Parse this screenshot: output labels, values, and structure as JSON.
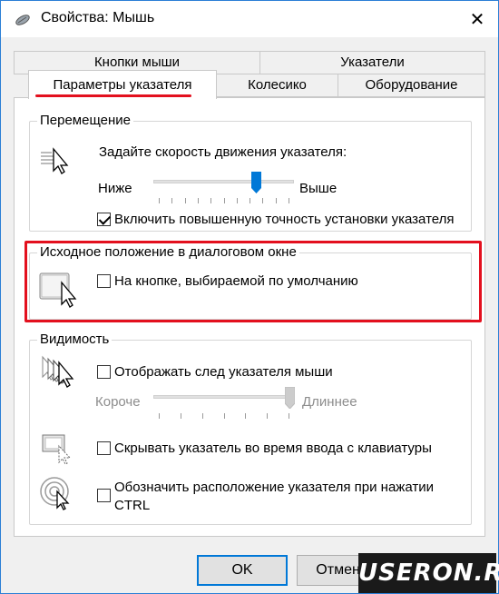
{
  "window": {
    "title": "Свойства: Мышь",
    "close_symbol": "✕"
  },
  "tabs": {
    "back_row": [
      {
        "label": "Кнопки мыши"
      },
      {
        "label": "Указатели"
      }
    ],
    "front_row": [
      {
        "label": "Параметры указателя",
        "active": true
      },
      {
        "label": "Колесико"
      },
      {
        "label": "Оборудование"
      }
    ]
  },
  "motion": {
    "title": "Перемещение",
    "prompt": "Задайте скорость движения указателя:",
    "min_label": "Ниже",
    "max_label": "Выше",
    "speed_level": 0.75,
    "precision_label": "Включить повышенную точность установки указателя",
    "precision_checked": true
  },
  "snap_to": {
    "title": "Исходное положение в диалоговом окне",
    "label": "На кнопке, выбираемой по умолчанию",
    "checked": false
  },
  "visibility": {
    "title": "Видимость",
    "trails_label": "Отображать след указателя мыши",
    "trails_checked": false,
    "short_label": "Короче",
    "long_label": "Длиннее",
    "trail_level": 1.0,
    "hide_label": "Скрывать указатель во время ввода с клавиатуры",
    "hide_checked": false,
    "ctrl_label_line1": "Обозначить расположение указателя при нажатии",
    "ctrl_label_line2": "CTRL",
    "ctrl_checked": false
  },
  "buttons": {
    "ok": "OK",
    "cancel": "Отмена"
  },
  "watermark": "USERON.RU",
  "colors": {
    "accent": "#0078d7",
    "highlight": "#e3101e",
    "title_border": "#2b7fd6"
  }
}
